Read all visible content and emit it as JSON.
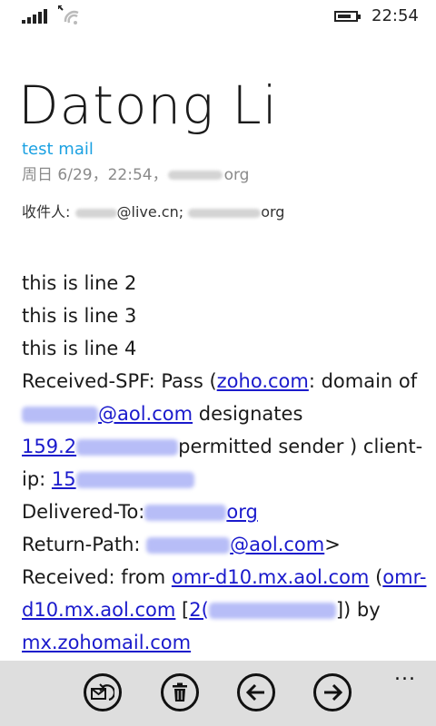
{
  "status": {
    "time": "22:54"
  },
  "header": {
    "sender": "Datong Li",
    "subject": "test mail",
    "date_prefix": "周日 6/29，22:54，",
    "date_suffix": "org",
    "to_label": "收件人:",
    "to_1_suffix": "@live.cn;",
    "to_2_suffix": "org"
  },
  "body": {
    "l1": "this is line 2",
    "l2": "this is line 3",
    "l3": "this is line 4",
    "spf_1": "Received-SPF: Pass (",
    "spf_link": "zoho.com",
    "spf_2": ": domain of",
    "aol_link_1": "@aol.com",
    "designates": " designates",
    "ip_link": "159.2",
    "permitted": "permitted sender )  client-",
    "ip_prefix": "ip: ",
    "ip_link2": "15",
    "delivered": "Delivered-To:",
    "delivered_link": "org",
    "return_path": "Return-Path: ",
    "aol_link_2": "@aol.com",
    "gt": ">",
    "received_1": "Received: from ",
    "omr_link": "omr-d10.mx.aol.com",
    "paren_open": " (",
    "omr_link2a": "omr-",
    "omr_link2b": "d10.mx.aol.com",
    "bracket": " [",
    "ip_link3": "2(",
    "by": "]) by",
    "zoho_link": "mx.zohomail.com"
  },
  "appbar": {
    "icons": [
      "reply-all-icon",
      "delete-icon",
      "previous-icon",
      "next-icon"
    ],
    "more": "..."
  }
}
